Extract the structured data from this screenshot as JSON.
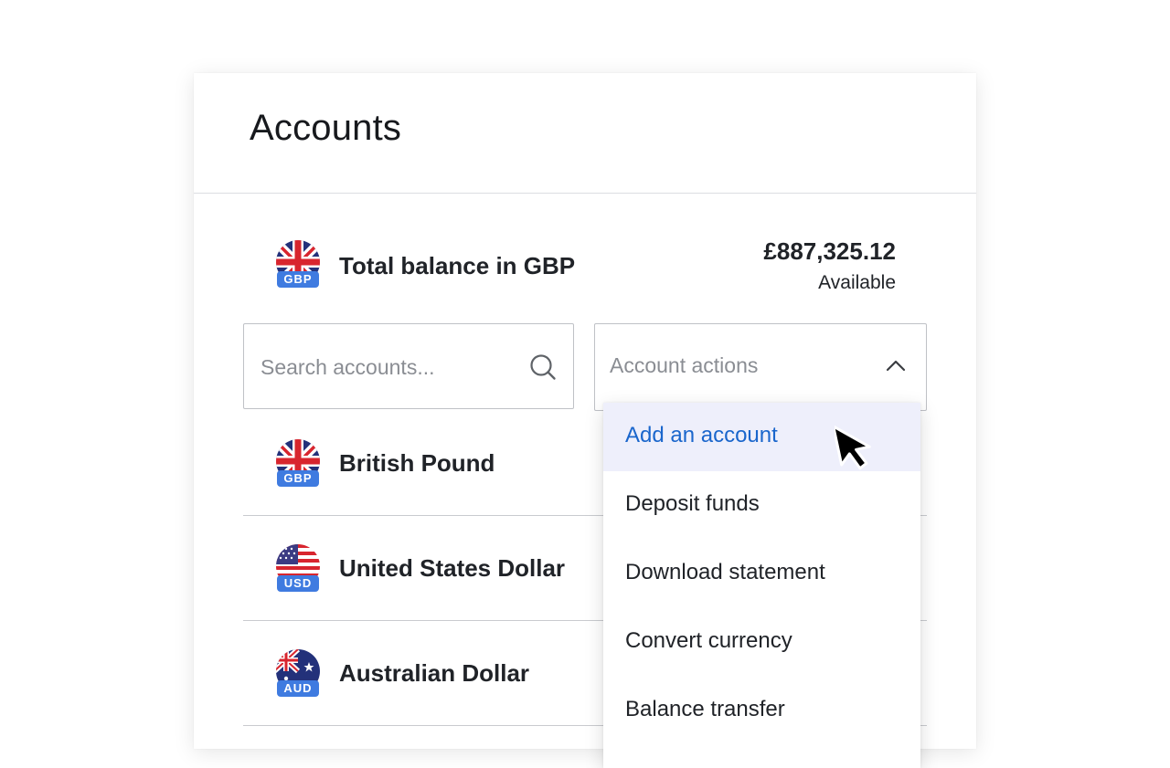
{
  "header": {
    "title": "Accounts"
  },
  "total": {
    "currency_code": "GBP",
    "label": "Total balance in GBP",
    "amount": "£887,325.12",
    "status": "Available"
  },
  "search": {
    "placeholder": "Search accounts..."
  },
  "actions": {
    "label": "Account actions",
    "menu_items": [
      "Add an account",
      "Deposit funds",
      "Download statement",
      "Convert currency",
      "Balance transfer"
    ],
    "active_index": 0
  },
  "accounts": [
    {
      "code": "GBP",
      "name": "British Pound"
    },
    {
      "code": "USD",
      "name": "United States Dollar"
    },
    {
      "code": "AUD",
      "name": "Australian Dollar"
    }
  ],
  "colors": {
    "accent": "#1a66cc",
    "badge": "#3f7be0",
    "menu_highlight": "#eeeffb",
    "uk_red": "#d8252e",
    "uk_blue": "#23317a",
    "us_blue": "#3b3b83"
  },
  "icons": {
    "search": "search-icon",
    "chevron": "chevron-up-icon",
    "cursor": "mouse-pointer-icon"
  }
}
